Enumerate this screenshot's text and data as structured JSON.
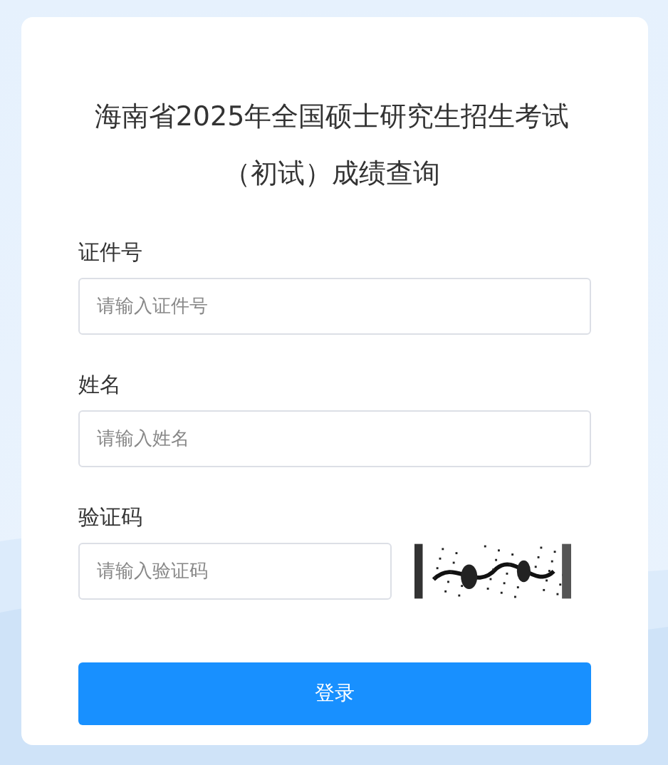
{
  "title": "海南省2025年全国硕士研究生招生考试（初试）成绩查询",
  "fields": [
    {
      "kind": "text",
      "label": "证件号",
      "placeholder": "请输入证件号"
    },
    {
      "kind": "text",
      "label": "姓名",
      "placeholder": "请输入姓名"
    },
    {
      "kind": "captcha",
      "label": "验证码",
      "placeholder": "请输入验证码"
    }
  ],
  "submit": "登录"
}
